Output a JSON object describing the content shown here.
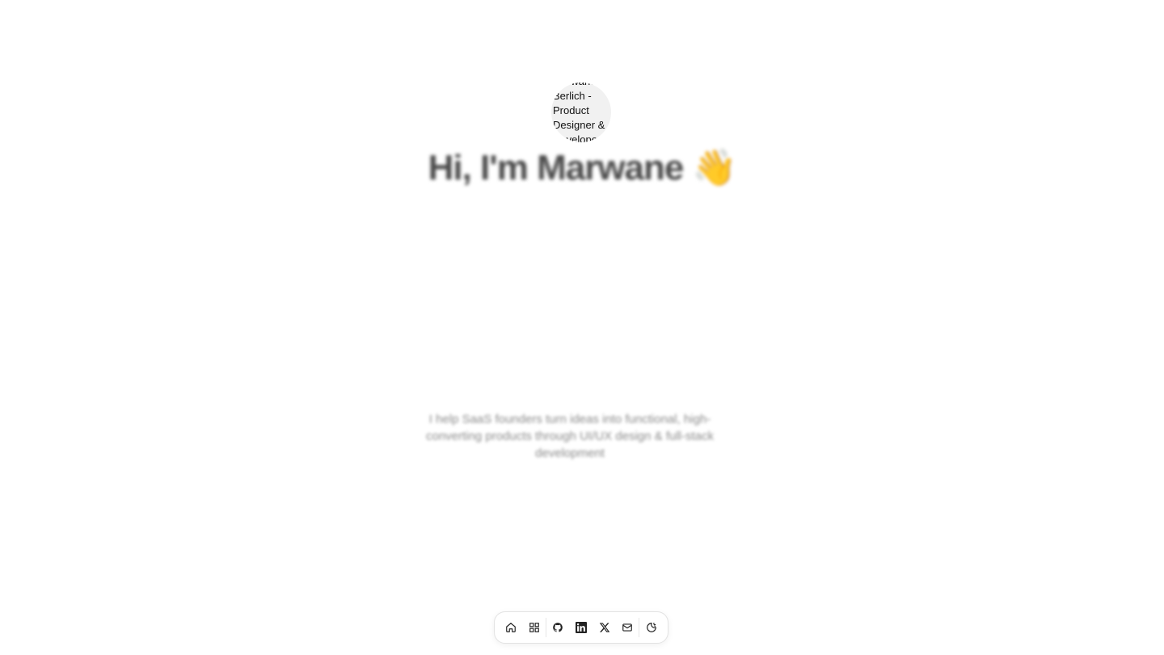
{
  "avatar": {
    "alt_text": "Marwane Berlich - Product Designer & Developer"
  },
  "hero": {
    "title": "Hi, I'm Marwane",
    "wave_emoji": "👋",
    "subtitle": "I help SaaS founders turn ideas into functional, high-converting products through UI/UX design & full-stack development"
  },
  "dock": {
    "items": [
      {
        "icon": "home-icon"
      },
      {
        "icon": "grid-icon"
      },
      {
        "icon": "github-icon"
      },
      {
        "icon": "linkedin-icon"
      },
      {
        "icon": "x-icon"
      },
      {
        "icon": "mail-icon"
      },
      {
        "icon": "theme-toggle-icon"
      }
    ]
  },
  "colors": {
    "title": "#4a4a4a",
    "subtitle": "#8a8a8a",
    "icon": "#222222",
    "dock_border": "#e3e3e3"
  }
}
